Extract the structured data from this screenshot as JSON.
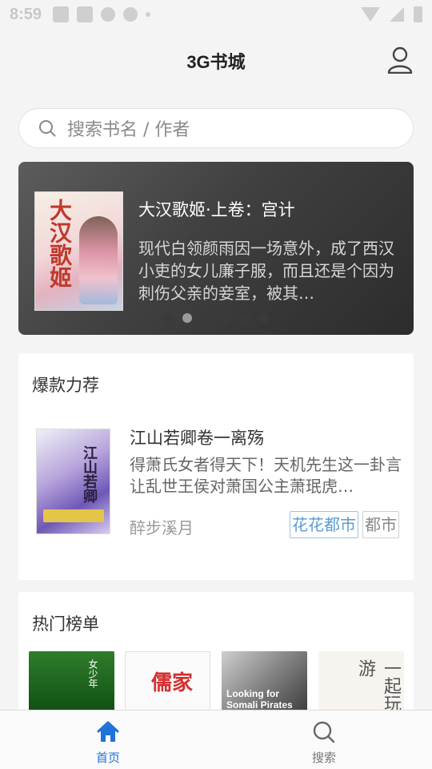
{
  "status_bar": {
    "time": "8:59"
  },
  "header": {
    "title": "3G书城"
  },
  "search": {
    "placeholder": "搜索书名 / 作者"
  },
  "banner": {
    "title": "大汉歌姬·上卷：宫计",
    "description": "现代白领颜雨因一场意外，成了西汉小吏的女儿廉子服，而且还是个因为刺伤父亲的妾室，被其…",
    "cover_text": "大汉歌姬",
    "dots": 6,
    "active_dot": 1
  },
  "recommend": {
    "section_title": "爆款力荐",
    "book": {
      "title": "江山若卿卷一离殇",
      "description": "得萧氏女者得天下！天机先生这一卦言让乱世王侯对萧国公主萧珉虎…",
      "author": "醉步溪月",
      "tags": [
        "花花都市",
        "都市"
      ],
      "cover_text": "江山若卿"
    }
  },
  "hot": {
    "section_title": "热门榜单",
    "covers": [
      "女少年",
      "儒家",
      "Looking for Somali Pirates",
      "和古人一起玩游"
    ]
  },
  "bottom_nav": {
    "items": [
      {
        "label": "首页",
        "icon": "home-icon",
        "active": true
      },
      {
        "label": "搜索",
        "icon": "search-icon",
        "active": false
      }
    ]
  },
  "colors": {
    "accent": "#1f73d8",
    "tag_blue": "#5b9bd5"
  }
}
